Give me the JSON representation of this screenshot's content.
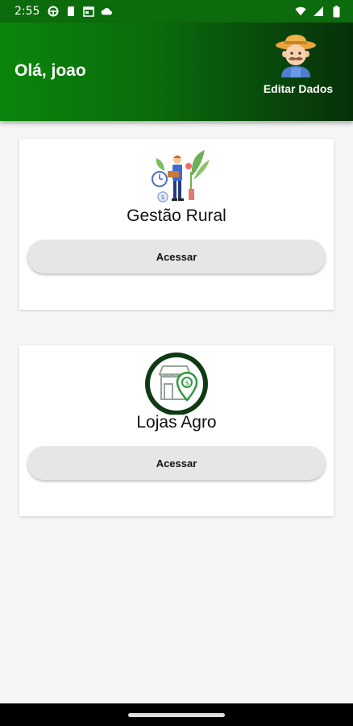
{
  "status_bar": {
    "time": "2:55",
    "icons": [
      "steering-wheel-icon",
      "sim-card-icon",
      "calendar-icon",
      "cloud-icon"
    ],
    "right_icons": [
      "wifi-icon",
      "signal-icon",
      "battery-icon"
    ]
  },
  "header": {
    "greeting": "Olá, joao",
    "edit_label": "Editar Dados",
    "avatar_icon": "farmer-avatar-icon",
    "gradient_start": "#0b850b",
    "gradient_end": "#07300a"
  },
  "cards": [
    {
      "title": "Gestão Rural",
      "button_label": "Acessar",
      "icon": "farmer-illustration-icon"
    },
    {
      "title": "Lojas Agro",
      "button_label": "Acessar",
      "icon": "agro-store-icon"
    }
  ],
  "colors": {
    "status_bar": "#0c6b0c",
    "background": "#f5f5f5",
    "button": "#e6e6e6"
  }
}
